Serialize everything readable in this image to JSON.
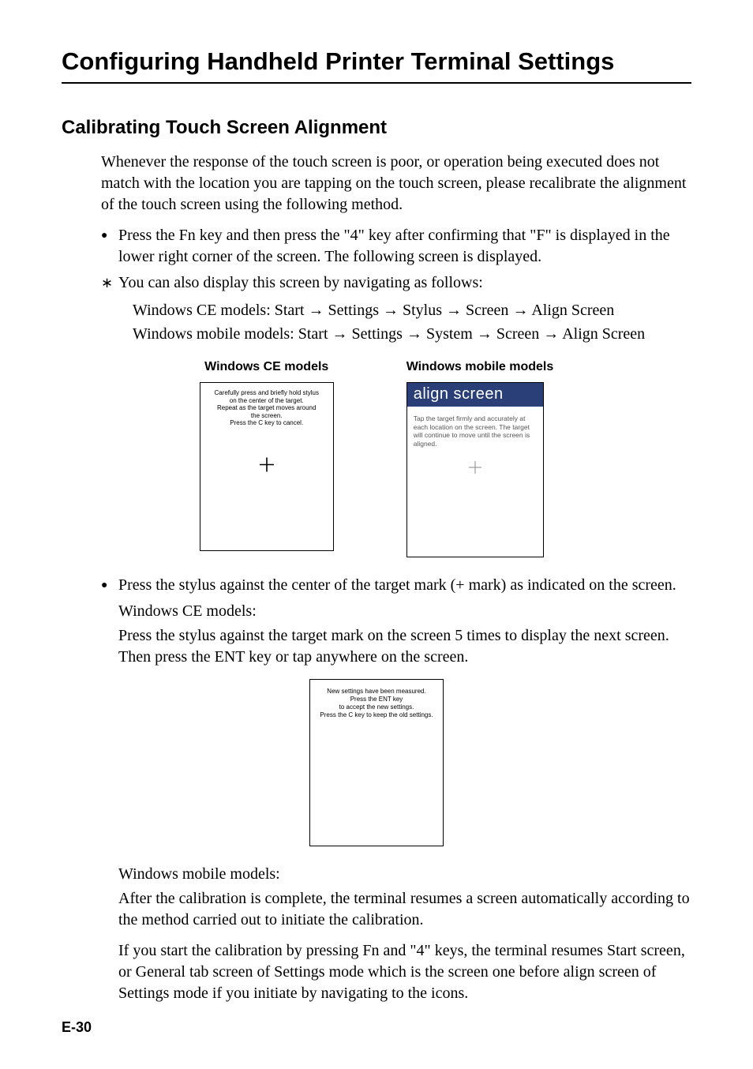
{
  "chapter_title": "Configuring Handheld Printer Terminal Settings",
  "section_title": "Calibrating Touch Screen Alignment",
  "intro": "Whenever the response of the touch screen is poor, or operation being executed does not match with the location you are tapping on the touch screen, please recalibrate the alignment of the touch screen using the following method.",
  "bullet1": "Press the Fn key and then press the \"4\" key after confirming that \"F\" is displayed in the lower right corner of the screen.  The following screen is displayed.",
  "star_note": "You can also display this screen by navigating as follows:",
  "nav_ce_prefix": "Windows CE models: Start ",
  "nav_ce_p2": " Settings ",
  "nav_ce_p3": " Stylus ",
  "nav_ce_p4": " Screen ",
  "nav_ce_p5": " Align Screen",
  "nav_mob_prefix": "Windows mobile models: Start ",
  "nav_mob_p2": " Settings ",
  "nav_mob_p3": " System ",
  "nav_mob_p4": " Screen ",
  "nav_mob_p5": " Align Screen",
  "arrow": "→",
  "fig_ce_label": "Windows CE models",
  "fig_mob_label": "Windows mobile models",
  "ce_screen": {
    "l1": "Carefully press and briefly hold stylus",
    "l2": "on the center of the target.",
    "l3": "Repeat as the target moves around",
    "l4": "the screen.",
    "l5": "Press the C key to cancel."
  },
  "mobile_screen": {
    "title": "align screen",
    "body": "Tap the target firmly and accurately at each location on the screen. The target will continue to move until the screen is aligned."
  },
  "bullet2": "Press the stylus against the center of the target mark (+ mark) as indicated on the screen.",
  "body_ce_label": "Windows CE models:",
  "body_ce_text": "Press the stylus against the target mark on the screen 5 times to display the next screen. Then press the ENT key or tap anywhere on the screen.",
  "ce_result": {
    "l1": "New settings have been measured.",
    "l2": "Press the ENT key",
    "l3": "to accept the new settings.",
    "l4": "Press the C key to keep the old settings."
  },
  "body_mob_label": "Windows mobile models:",
  "body_mob_text1": "After the calibration is complete, the terminal resumes a screen automatically according to the method carried out to initiate the calibration.",
  "body_mob_text2": "If you start the calibration by pressing Fn and \"4\" keys, the terminal resumes Start screen, or General tab screen of Settings mode which is the screen one before align screen of Settings mode if you initiate by navigating to the icons.",
  "page_number": "E-30"
}
